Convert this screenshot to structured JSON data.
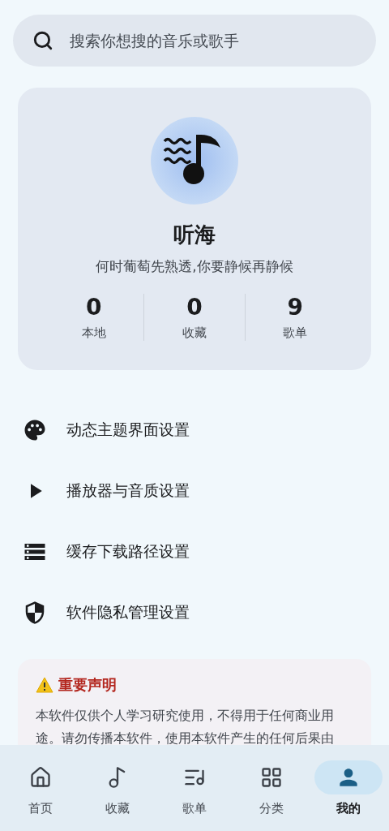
{
  "search": {
    "placeholder": "搜索你想搜的音乐或歌手"
  },
  "profile": {
    "name": "听海",
    "motto": "何时葡萄先熟透,你要静候再静候",
    "stats": [
      {
        "value": "0",
        "label": "本地"
      },
      {
        "value": "0",
        "label": "收藏"
      },
      {
        "value": "9",
        "label": "歌单"
      }
    ]
  },
  "settings": [
    {
      "kind": "palette",
      "label": "动态主题界面设置"
    },
    {
      "kind": "play",
      "label": "播放器与音质设置"
    },
    {
      "kind": "storage",
      "label": "缓存下载路径设置"
    },
    {
      "kind": "shield",
      "label": "软件隐私管理设置"
    }
  ],
  "notice": {
    "title": "重要声明",
    "text": "本软件仅供个人学习研究使用，不得用于任何商业用途。请勿传播本软件，使用本软件产生的任何后果由"
  },
  "nav": [
    {
      "kind": "home",
      "label": "首页",
      "selected": false
    },
    {
      "kind": "favorites",
      "label": "收藏",
      "selected": false
    },
    {
      "kind": "playlist",
      "label": "歌单",
      "selected": false
    },
    {
      "kind": "category",
      "label": "分类",
      "selected": false
    },
    {
      "kind": "mine",
      "label": "我的",
      "selected": true
    }
  ]
}
